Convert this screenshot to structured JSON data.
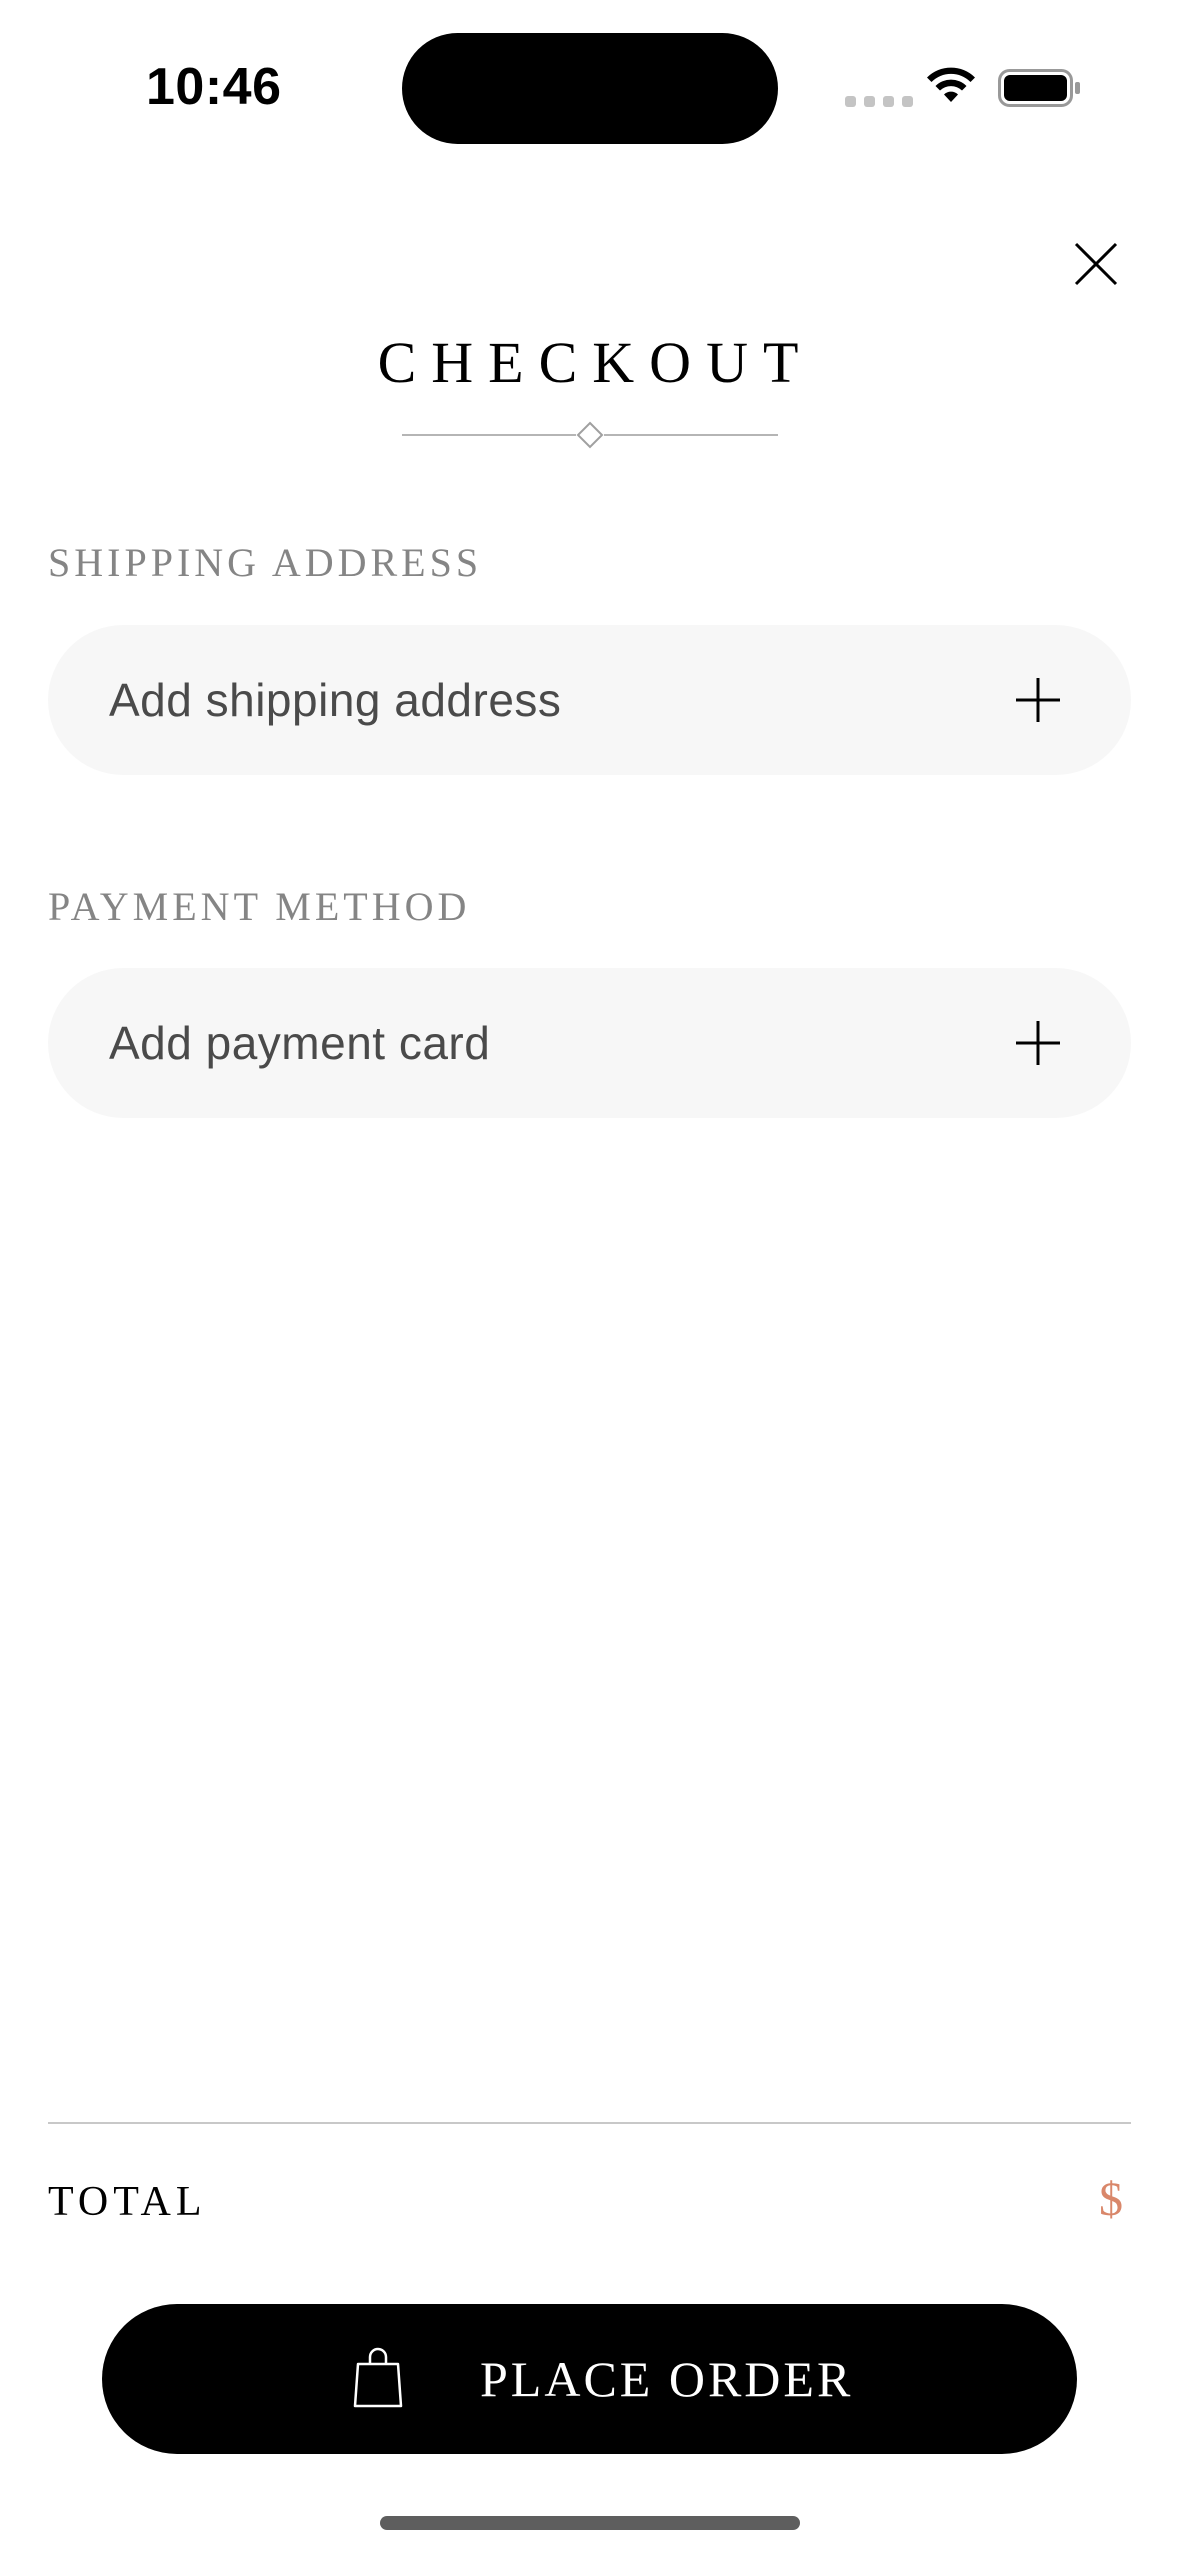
{
  "status_bar": {
    "time": "10:46",
    "icons": [
      "cellular-signal-icon",
      "wifi-icon",
      "battery-icon"
    ]
  },
  "header": {
    "title": "CHECKOUT",
    "close_icon": "close-icon"
  },
  "shipping": {
    "section_label": "SHIPPING ADDRESS",
    "add_label": "Add shipping address",
    "icon": "plus-icon"
  },
  "payment": {
    "section_label": "PAYMENT METHOD",
    "add_label": "Add payment card",
    "icon": "plus-icon"
  },
  "footer": {
    "total_label": "TOTAL",
    "total_value": "$",
    "place_order_label": "PLACE ORDER",
    "place_order_icon": "shopping-bag-icon"
  },
  "colors": {
    "accent_price": "#d9876a",
    "button_background": "#000000",
    "row_background": "#f7f7f7",
    "section_label": "#858585"
  }
}
